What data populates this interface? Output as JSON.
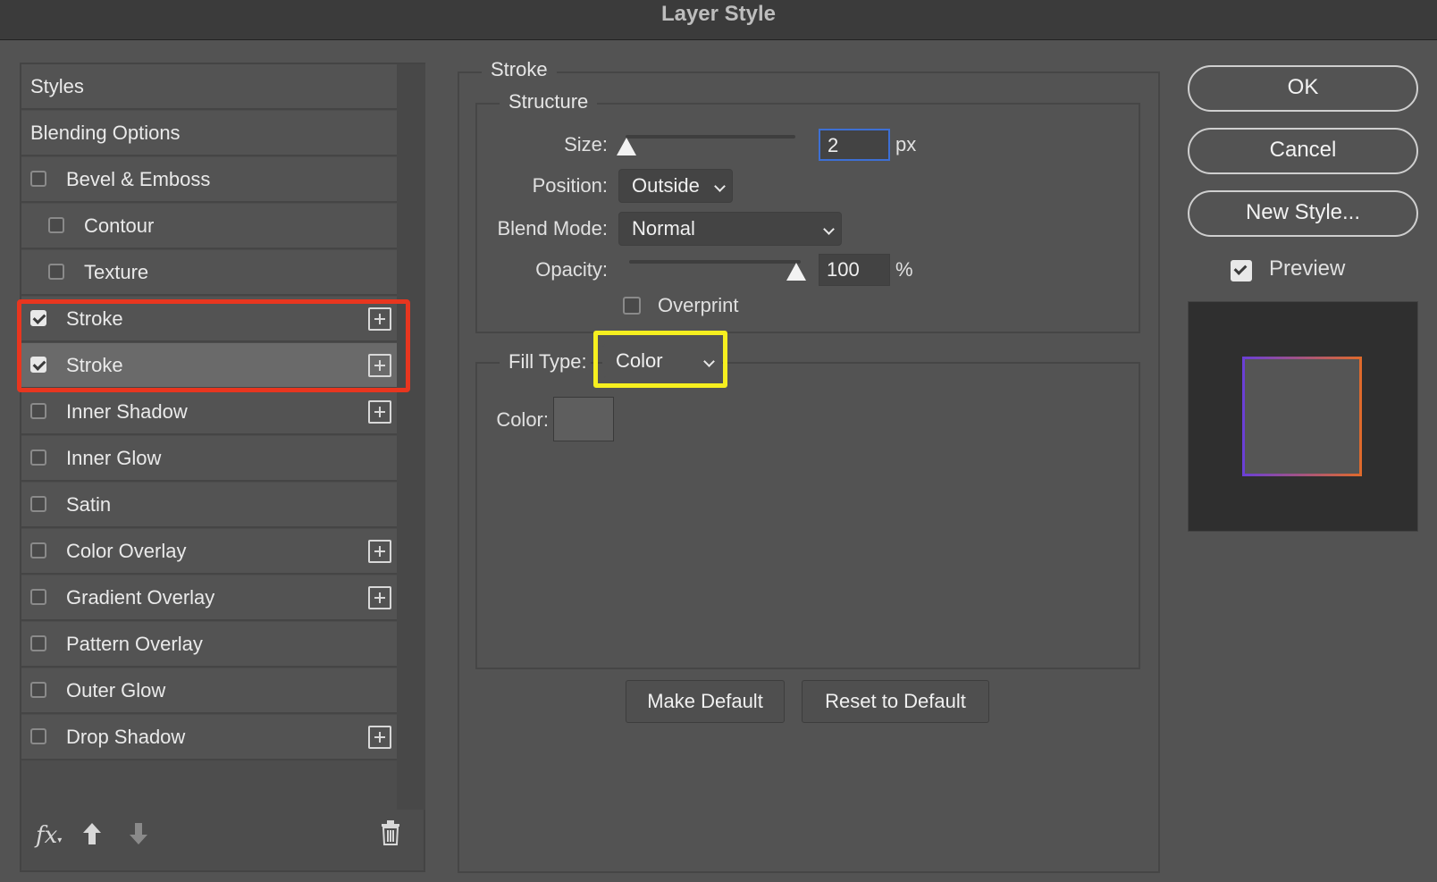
{
  "window": {
    "title": "Layer Style"
  },
  "styles_panel": {
    "items": [
      {
        "label": "Styles",
        "checkbox": false,
        "plus": false,
        "indent": false,
        "checked": false,
        "selected": false
      },
      {
        "label": "Blending Options",
        "checkbox": false,
        "plus": false,
        "indent": false,
        "checked": false,
        "selected": false
      },
      {
        "label": "Bevel & Emboss",
        "checkbox": true,
        "plus": false,
        "indent": false,
        "checked": false,
        "selected": false
      },
      {
        "label": "Contour",
        "checkbox": true,
        "plus": false,
        "indent": true,
        "checked": false,
        "selected": false
      },
      {
        "label": "Texture",
        "checkbox": true,
        "plus": false,
        "indent": true,
        "checked": false,
        "selected": false
      },
      {
        "label": "Stroke",
        "checkbox": true,
        "plus": true,
        "indent": false,
        "checked": true,
        "selected": false
      },
      {
        "label": "Stroke",
        "checkbox": true,
        "plus": true,
        "indent": false,
        "checked": true,
        "selected": true
      },
      {
        "label": "Inner Shadow",
        "checkbox": true,
        "plus": true,
        "indent": false,
        "checked": false,
        "selected": false
      },
      {
        "label": "Inner Glow",
        "checkbox": true,
        "plus": false,
        "indent": false,
        "checked": false,
        "selected": false
      },
      {
        "label": "Satin",
        "checkbox": true,
        "plus": false,
        "indent": false,
        "checked": false,
        "selected": false
      },
      {
        "label": "Color Overlay",
        "checkbox": true,
        "plus": true,
        "indent": false,
        "checked": false,
        "selected": false
      },
      {
        "label": "Gradient Overlay",
        "checkbox": true,
        "plus": true,
        "indent": false,
        "checked": false,
        "selected": false
      },
      {
        "label": "Pattern Overlay",
        "checkbox": true,
        "plus": false,
        "indent": false,
        "checked": false,
        "selected": false
      },
      {
        "label": "Outer Glow",
        "checkbox": true,
        "plus": false,
        "indent": false,
        "checked": false,
        "selected": false
      },
      {
        "label": "Drop Shadow",
        "checkbox": true,
        "plus": true,
        "indent": false,
        "checked": false,
        "selected": false
      }
    ],
    "toolbar": {
      "fx_label": "fx"
    }
  },
  "stroke": {
    "section_title": "Stroke",
    "structure": {
      "title": "Structure",
      "size_label": "Size:",
      "size_value": "2",
      "size_unit": "px",
      "position_label": "Position:",
      "position_value": "Outside",
      "blend_label": "Blend Mode:",
      "blend_value": "Normal",
      "opacity_label": "Opacity:",
      "opacity_value": "100",
      "opacity_unit": "%",
      "overprint_label": "Overprint"
    },
    "fill": {
      "label": "Fill Type:",
      "value": "Color",
      "color_label": "Color:",
      "swatch_color": "#5e5e5e"
    },
    "make_default": "Make Default",
    "reset_default": "Reset to Default"
  },
  "actions": {
    "ok": "OK",
    "cancel": "Cancel",
    "new_style": "New Style...",
    "preview_label": "Preview"
  },
  "preview": {
    "background": "#2f2f2f",
    "fill": "#555555",
    "gradient_start": "#6a3fd8",
    "gradient_end": "#e06a2a"
  },
  "annotations": {
    "red": "#e8361f",
    "yellow": "#f6ef1f"
  }
}
